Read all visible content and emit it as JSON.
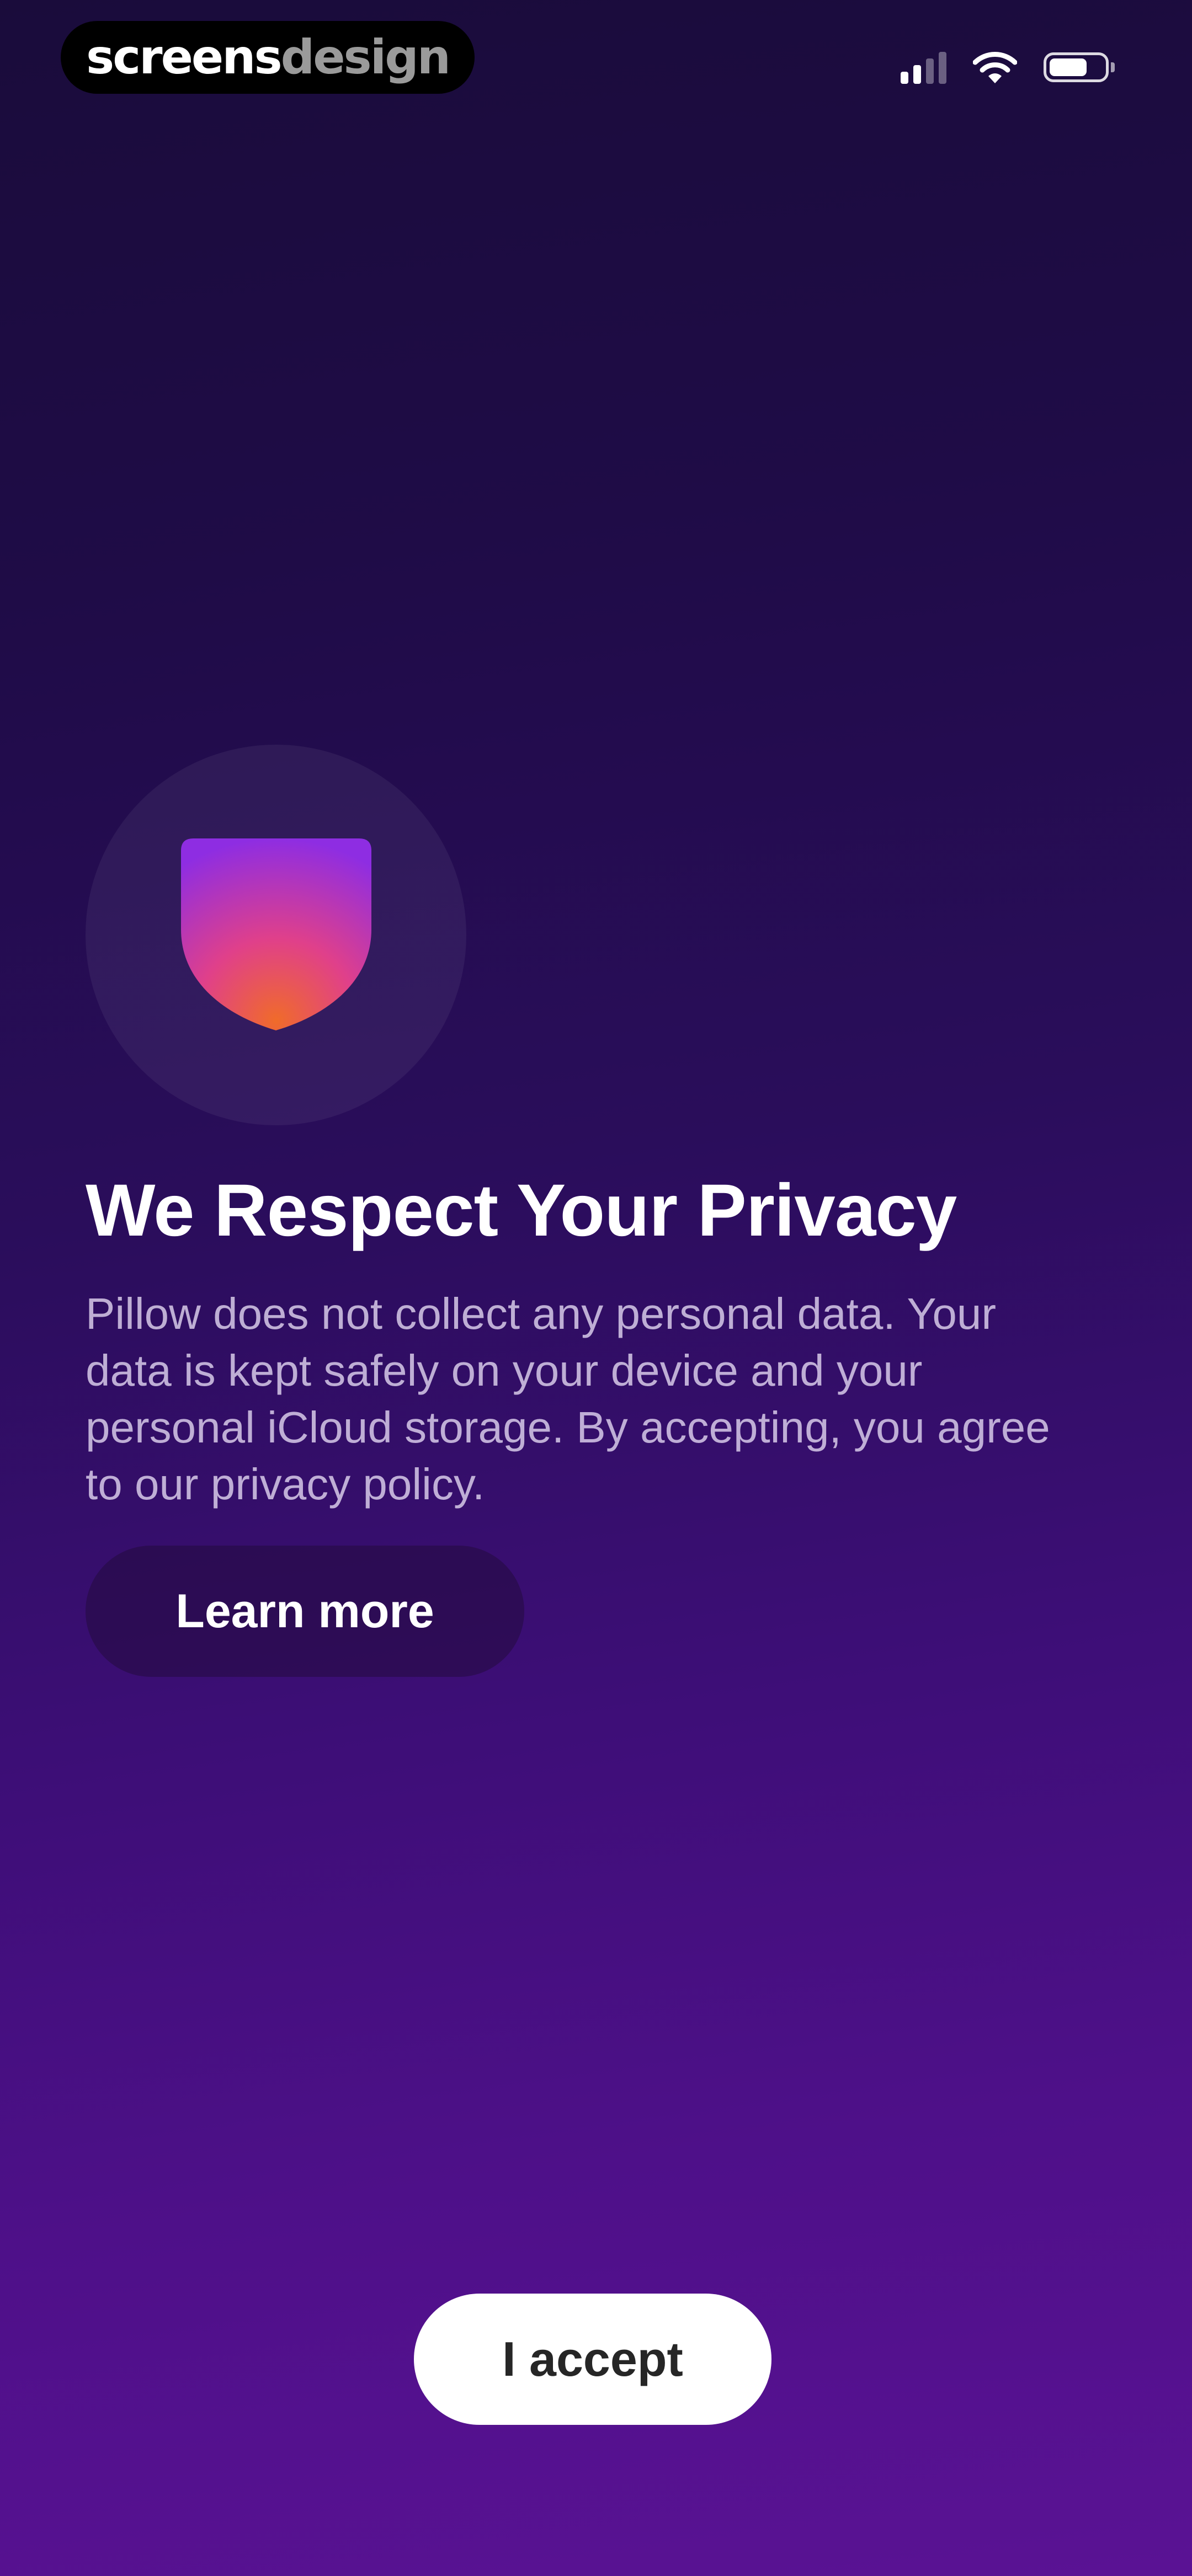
{
  "watermark": {
    "part1": "screens",
    "part2": "design"
  },
  "status_bar": {
    "signal_icon": "cellular-signal-icon",
    "wifi_icon": "wifi-icon",
    "battery_icon": "battery-icon",
    "battery_level": 0.7
  },
  "hero": {
    "icon": "shield-icon",
    "shield_gradient": [
      "#8e2de2",
      "#e0408a",
      "#f06b2a"
    ]
  },
  "content": {
    "title": "We Respect Your Privacy",
    "description": "Pillow does not collect any personal data. Your data is kept safely on your device and your personal iCloud storage. By accepting, you agree to our privacy policy."
  },
  "buttons": {
    "learn_more": "Learn more",
    "accept": "I accept"
  },
  "colors": {
    "background_top": "#1a0c3b",
    "background_bottom": "#5a1294",
    "accept_button": "#ffffff",
    "accept_text": "#262626"
  }
}
